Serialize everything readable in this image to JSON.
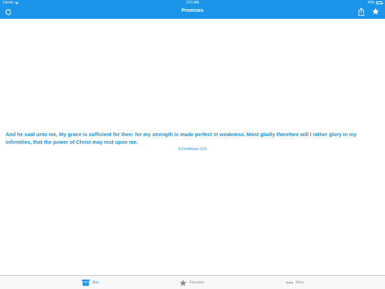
{
  "status_bar": {
    "carrier": "Carrier",
    "time": "2:51 AM",
    "battery": "43%"
  },
  "nav": {
    "title": "Promises",
    "left_icon": "refresh-icon",
    "right_icons": [
      "share-icon",
      "star-icon"
    ]
  },
  "verse": {
    "text": "And he said unto me, My grace is sufficient for thee: for my strength is made perfect in weakness. Most gladly therefore will I rather glory in my infirmities, that the power of Christ may rest upon me.",
    "reference": "II Corinthians 12:9"
  },
  "tabs": [
    {
      "label": "Box",
      "icon": "box-icon",
      "selected": true
    },
    {
      "label": "Favorites",
      "icon": "star-icon",
      "selected": false
    },
    {
      "label": "More",
      "icon": "more-icon",
      "selected": false
    }
  ],
  "colors": {
    "accent": "#1a95ea",
    "verse": "#1a8fe0",
    "tab_inactive": "#8e8e93"
  }
}
